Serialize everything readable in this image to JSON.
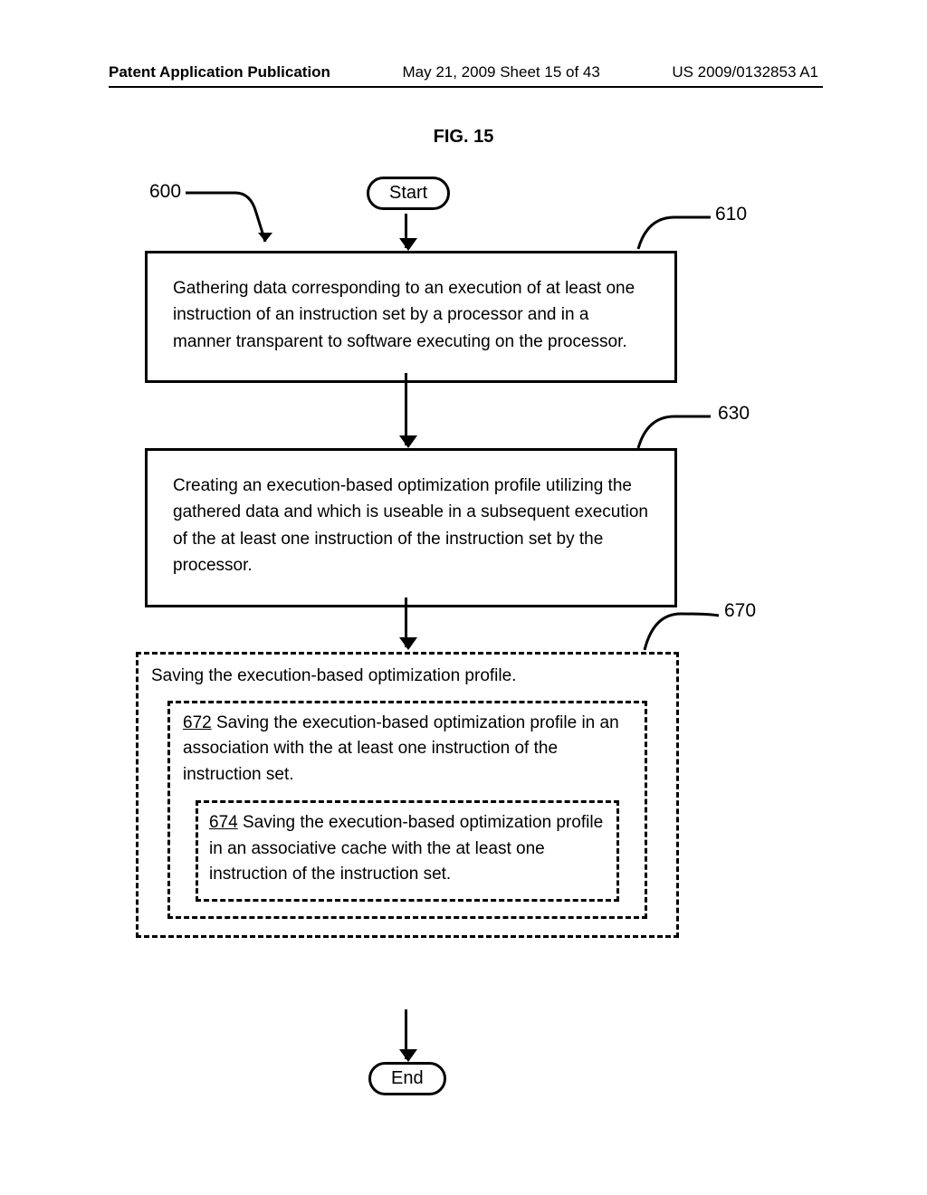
{
  "header": {
    "left": "Patent Application Publication",
    "mid": "May 21, 2009  Sheet 15 of 43",
    "right": "US 2009/0132853 A1"
  },
  "figure_label": "FIG. 15",
  "refs": {
    "r600": "600",
    "r610": "610",
    "r630": "630",
    "r670": "670",
    "r672": "672",
    "r674": "674"
  },
  "nodes": {
    "start": "Start",
    "end": "End",
    "step610": "Gathering data corresponding to an execution of at least one instruction of an instruction set by a processor and in a manner transparent to software executing on the processor.",
    "step630": "Creating an execution-based optimization profile utilizing the gathered data and which is useable in a subsequent execution of the at least one instruction of the instruction set by the processor.",
    "step670_main": "Saving the execution-based optimization profile.",
    "step672": "  Saving the execution-based optimization profile in an association with the at least one instruction of the instruction set.",
    "step674": "  Saving the execution-based optimization profile in an associative cache with the at least one instruction of the instruction set."
  }
}
